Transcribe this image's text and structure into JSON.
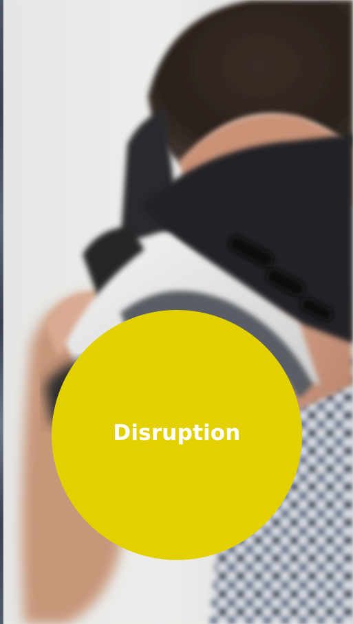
{
  "slide": {
    "caption": "Disruption",
    "accent_color": "#e3d000",
    "caption_color": "#ffffff",
    "background_photo": "person-wearing-vr-headset"
  }
}
